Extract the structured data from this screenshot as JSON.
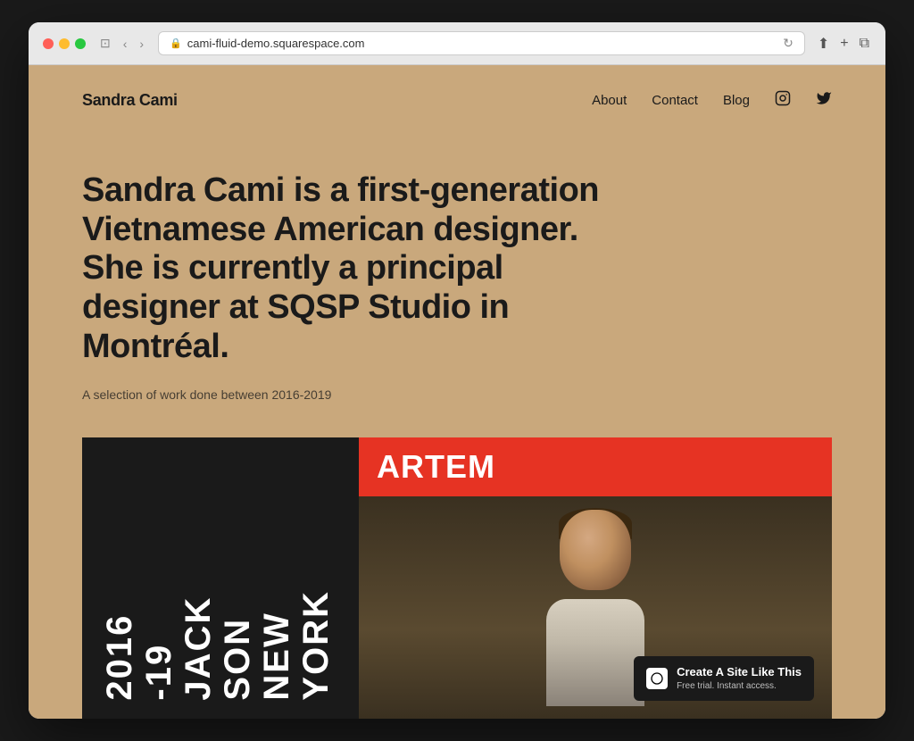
{
  "browser": {
    "url": "cami-fluid-demo.squarespace.com",
    "lock_icon": "🔒",
    "refresh_icon": "↻",
    "back_icon": "‹",
    "forward_icon": "›",
    "window_icon": "⊡",
    "share_icon": "⬆",
    "add_tab_icon": "+",
    "duplicate_icon": "⧉"
  },
  "site": {
    "logo": "Sandra Cami",
    "nav": {
      "links": [
        "About",
        "Contact",
        "Blog"
      ],
      "instagram_icon": "instagram",
      "twitter_icon": "twitter"
    },
    "hero": {
      "text": "Sandra Cami is a first-generation Vietnamese American designer. She is currently a principal designer at SQSP Studio in Montréal.",
      "subtitle": "A selection of work done between 2016-2019"
    },
    "portfolio": {
      "left_text": "2016-19\nJACKSON\nNEW YORK",
      "artem_label": "ARTEM",
      "artem_bg_color": "#e63323"
    },
    "badge": {
      "logo_text": "S",
      "main_text": "Create A Site Like This",
      "sub_text": "Free trial. Instant access."
    }
  }
}
